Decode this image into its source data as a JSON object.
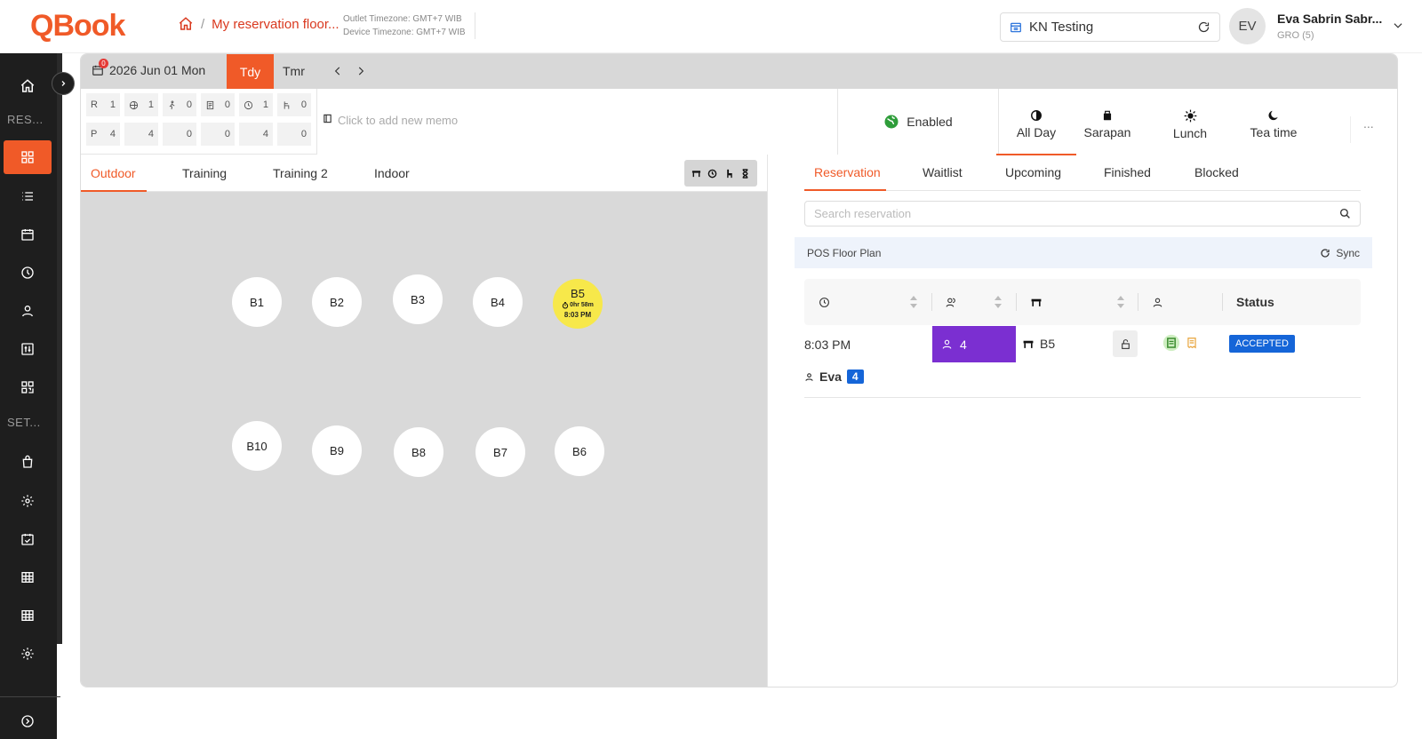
{
  "app": {
    "logo": "QBook"
  },
  "header": {
    "breadcrumb_current": "My reservation floor...",
    "outlet_timezone": "Outlet Timezone: GMT+7 WIB",
    "device_timezone": "Device Timezone: GMT+7 WIB",
    "outlet_name": "KN Testing",
    "avatar_initials": "EV",
    "user_name": "Eva Sabrin Sabr...",
    "user_role": "GRO (5)"
  },
  "sidebar": {
    "section_reservation": "RES...",
    "section_settings": "SET..."
  },
  "datebar": {
    "badge": "0",
    "date": "2026 Jun 01 Mon",
    "today": "Tdy",
    "tomorrow": "Tmr"
  },
  "stats": {
    "r_label": "R",
    "p_label": "P",
    "r": [
      "1",
      "1",
      "0",
      "0",
      "1",
      "0"
    ],
    "p": [
      "4",
      "4",
      "0",
      "0",
      "4",
      "0"
    ]
  },
  "memo": {
    "placeholder": "Click to add new memo"
  },
  "status": {
    "label": "Enabled"
  },
  "shifts": [
    "All Day",
    "Sarapan",
    "Lunch",
    "Tea time"
  ],
  "more": "...",
  "areas": [
    "Outdoor",
    "Training",
    "Training 2",
    "Indoor"
  ],
  "tables": {
    "B1": "B1",
    "B2": "B2",
    "B3": "B3",
    "B4": "B4",
    "B5": {
      "label": "B5",
      "timer": "0hr 58m",
      "time": "8:03 PM"
    },
    "B6": "B6",
    "B7": "B7",
    "B8": "B8",
    "B9": "B9",
    "B10": "B10"
  },
  "list_tabs": [
    "Reservation",
    "Waitlist",
    "Upcoming",
    "Finished",
    "Blocked"
  ],
  "search": {
    "placeholder": "Search reservation"
  },
  "pos": {
    "title": "POS Floor Plan",
    "sync": "Sync"
  },
  "columns": {
    "status": "Status"
  },
  "reservations": [
    {
      "time": "8:03 PM",
      "pax": "4",
      "table": "B5",
      "status": "ACCEPTED",
      "guest": "Eva",
      "guest_count": "4"
    }
  ],
  "colors": {
    "brand": "#f05a28",
    "pax_bg": "#7b2fd1",
    "accepted": "#1565d8",
    "busy_table": "#f7e84a"
  }
}
